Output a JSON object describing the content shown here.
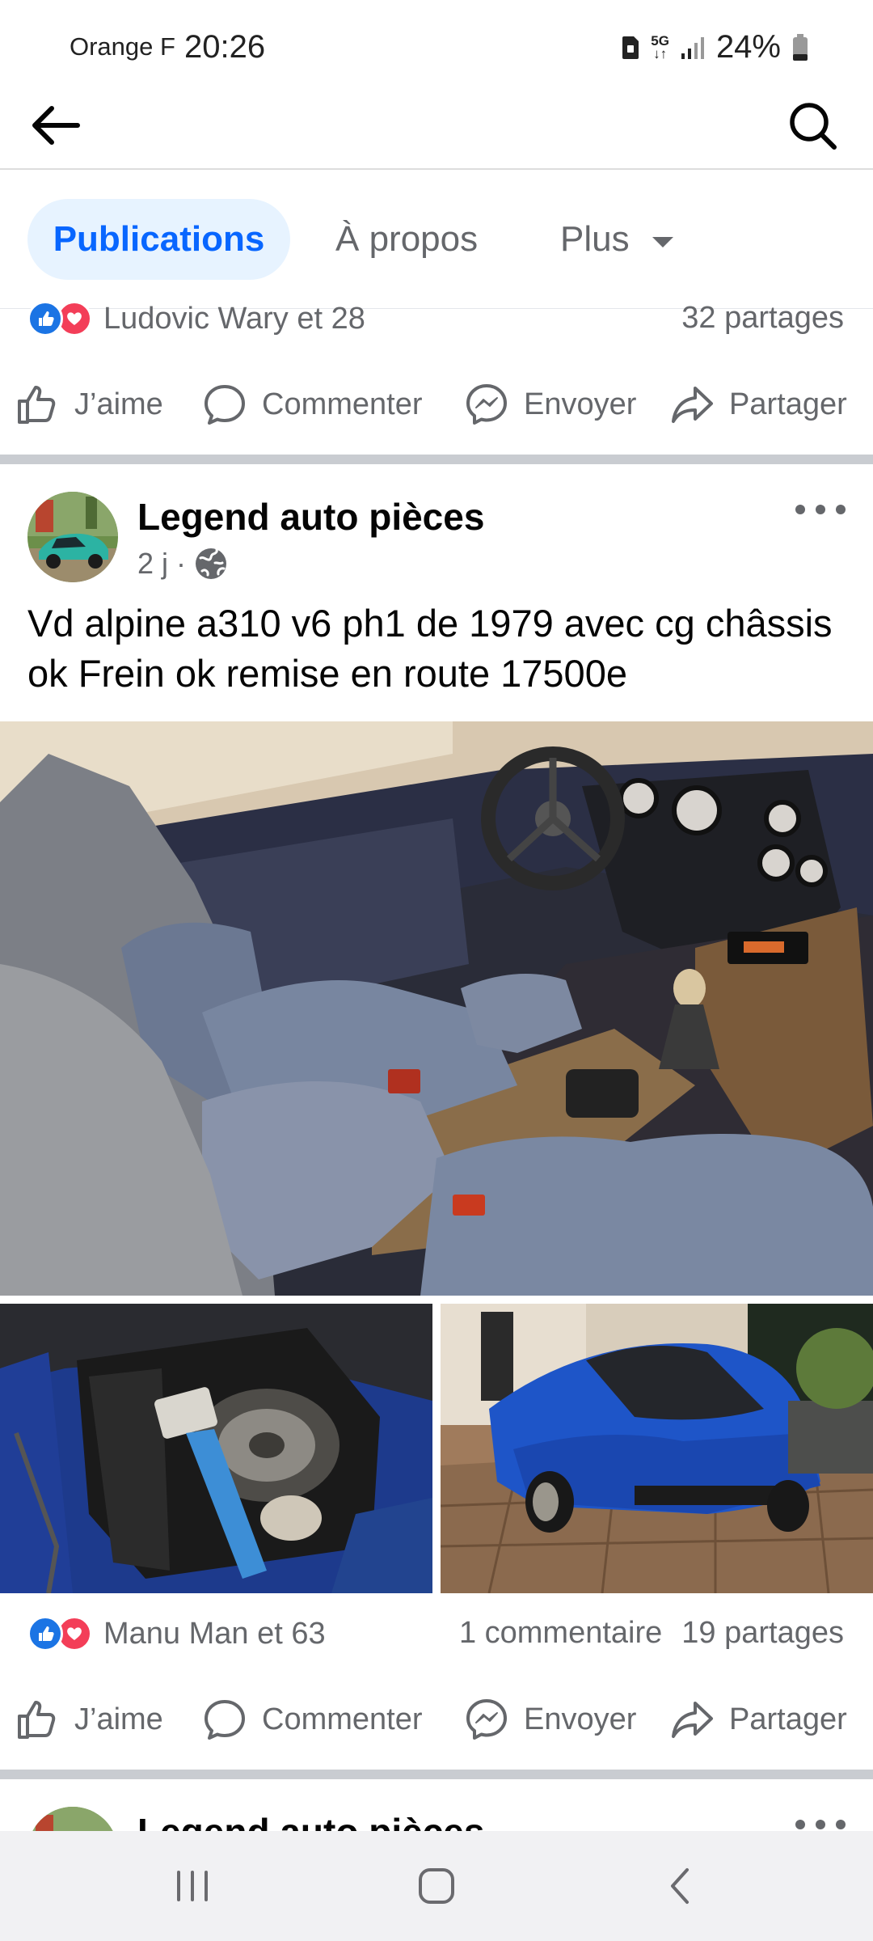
{
  "status_bar": {
    "carrier": "Orange F",
    "time": "20:26",
    "network": "5G",
    "battery": "24%"
  },
  "tabs": {
    "publications": "Publications",
    "about": "À propos",
    "more": "Plus"
  },
  "previous_post": {
    "reactions_text": "Ludovic Wary et 28",
    "shares": "32 partages"
  },
  "actions": {
    "like": "J’aime",
    "comment": "Commenter",
    "send": "Envoyer",
    "share": "Partager"
  },
  "post": {
    "author": "Legend auto pièces",
    "time": "2 j",
    "separator": "·",
    "text": "Vd alpine a310 v6 ph1 de 1979 avec cg châssis ok Frein ok remise en route 17500e",
    "reactions_text": "Manu Man et 63",
    "comments": "1 commentaire",
    "shares": "19 partages"
  },
  "next_post": {
    "author": "Legend auto pièces"
  },
  "colors": {
    "accent": "#0866ff",
    "like_blue": "#1b74e4",
    "love_red": "#f33e58",
    "secondary_text": "#65676b"
  }
}
